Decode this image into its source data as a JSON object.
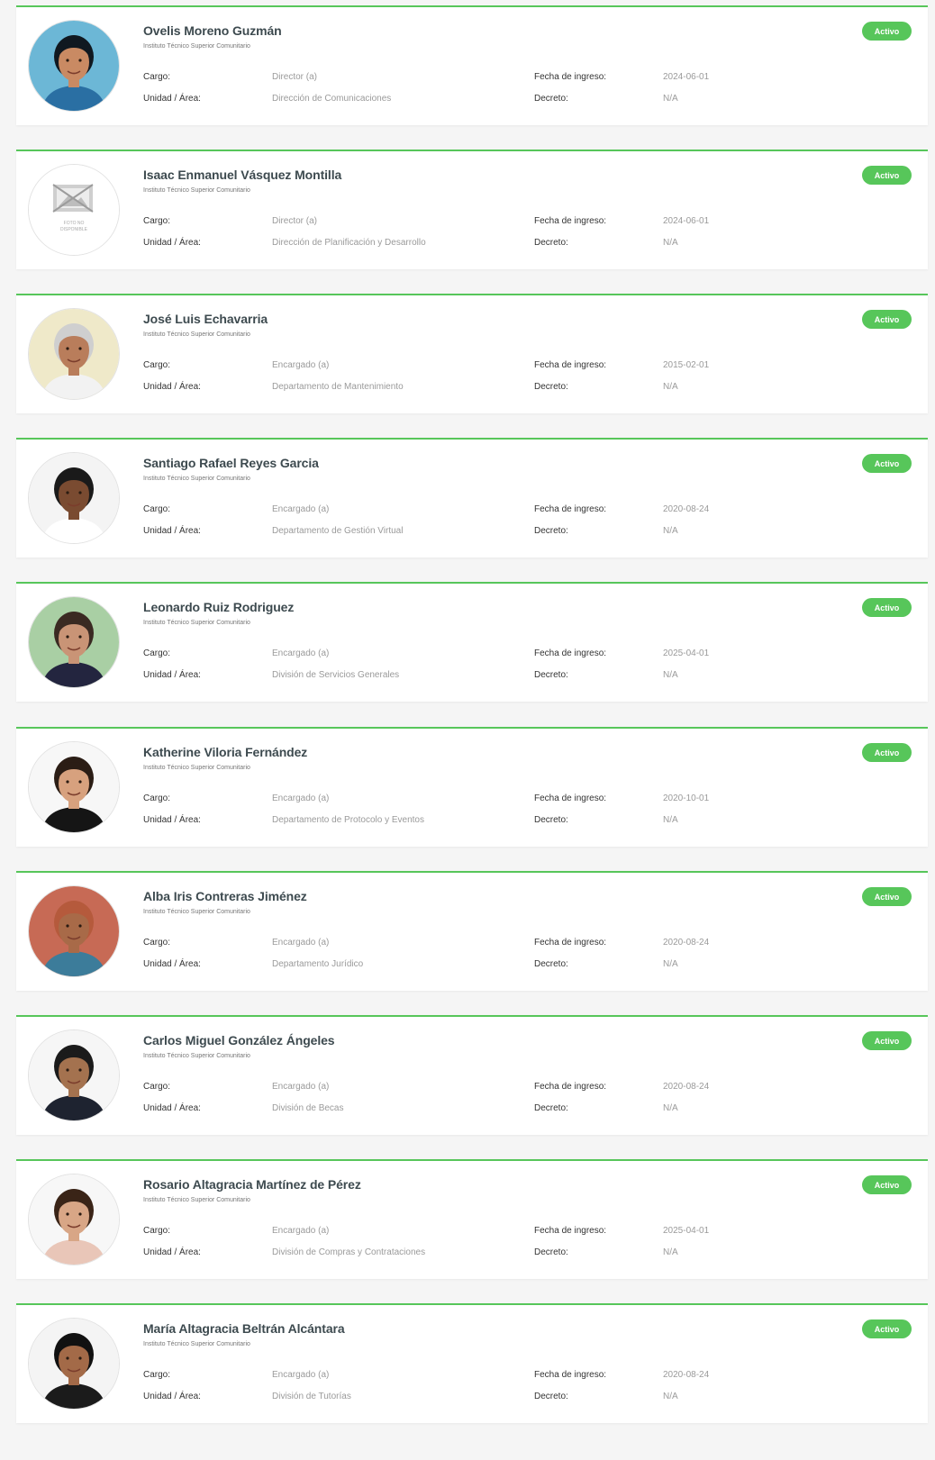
{
  "labels": {
    "cargo": "Cargo:",
    "unidad": "Unidad / Área:",
    "fecha": "Fecha de ingreso:",
    "decreto": "Decreto:"
  },
  "colors": {
    "accent": "#57c65a",
    "card_bg": "#ffffff",
    "page_bg": "#f5f5f5"
  },
  "people": [
    {
      "name": "Ovelis Moreno Guzmán",
      "institution": "Instituto Técnico Superior Comunitario",
      "cargo": "Director (a)",
      "unidad": "Dirección de Comunicaciones",
      "fecha": "2024-06-01",
      "decreto": "N/A",
      "status": "Activo",
      "avatar": {
        "kind": "photo",
        "icon": "person-photo-icon",
        "bg": "#6cb7d6",
        "skin": "#c98a63",
        "hair": "#101820",
        "shirt": "#2a6fa3"
      }
    },
    {
      "name": "Isaac Enmanuel Vásquez Montilla",
      "institution": "Instituto Técnico Superior Comunitario",
      "cargo": "Director (a)",
      "unidad": "Dirección de Planificación y Desarrollo",
      "fecha": "2024-06-01",
      "decreto": "N/A",
      "status": "Activo",
      "avatar": {
        "kind": "placeholder",
        "icon": "no-photo-icon",
        "line1": "FOTO NO",
        "line2": "DISPONIBLE"
      }
    },
    {
      "name": "José Luis Echavarria",
      "institution": "Instituto Técnico Superior Comunitario",
      "cargo": "Encargado (a)",
      "unidad": "Departamento de Mantenimiento",
      "fecha": "2015-02-01",
      "decreto": "N/A",
      "status": "Activo",
      "avatar": {
        "kind": "photo",
        "icon": "person-photo-icon",
        "bg": "#efe9c9",
        "skin": "#b97d5b",
        "hair": "#cfcfcf",
        "shirt": "#f2f2f2"
      }
    },
    {
      "name": "Santiago Rafael Reyes Garcia",
      "institution": "Instituto Técnico Superior Comunitario",
      "cargo": "Encargado (a)",
      "unidad": "Departamento de Gestión Virtual",
      "fecha": "2020-08-24",
      "decreto": "N/A",
      "status": "Activo",
      "avatar": {
        "kind": "photo",
        "icon": "person-photo-icon",
        "bg": "#f4f4f4",
        "skin": "#7a4b31",
        "hair": "#1a1a1a",
        "shirt": "#ffffff"
      }
    },
    {
      "name": "Leonardo Ruiz Rodriguez",
      "institution": "Instituto Técnico Superior Comunitario",
      "cargo": "Encargado (a)",
      "unidad": "División de Servicios Generales",
      "fecha": "2025-04-01",
      "decreto": "N/A",
      "status": "Activo",
      "avatar": {
        "kind": "photo",
        "icon": "person-photo-icon",
        "bg": "#a9cfa4",
        "skin": "#c99476",
        "hair": "#3a2a22",
        "shirt": "#23253f"
      }
    },
    {
      "name": "Katherine Viloria Fernández",
      "institution": "Instituto Técnico Superior Comunitario",
      "cargo": "Encargado (a)",
      "unidad": "Departamento de Protocolo y Eventos",
      "fecha": "2020-10-01",
      "decreto": "N/A",
      "status": "Activo",
      "avatar": {
        "kind": "photo",
        "icon": "person-photo-icon",
        "bg": "#f7f7f7",
        "skin": "#d7a17e",
        "hair": "#2b1d15",
        "shirt": "#151515"
      }
    },
    {
      "name": "Alba Iris Contreras Jiménez",
      "institution": "Instituto Técnico Superior Comunitario",
      "cargo": "Encargado (a)",
      "unidad": "Departamento Jurídico",
      "fecha": "2020-08-24",
      "decreto": "N/A",
      "status": "Activo",
      "avatar": {
        "kind": "photo",
        "icon": "person-photo-icon",
        "bg": "#c76a55",
        "skin": "#a86a48",
        "hair": "#b55a3c",
        "shirt": "#3c7c9a"
      }
    },
    {
      "name": "Carlos Miguel González Ángeles",
      "institution": "Instituto Técnico Superior Comunitario",
      "cargo": "Encargado (a)",
      "unidad": "División de Becas",
      "fecha": "2020-08-24",
      "decreto": "N/A",
      "status": "Activo",
      "avatar": {
        "kind": "photo",
        "icon": "person-photo-icon",
        "bg": "#f6f6f6",
        "skin": "#a4724f",
        "hair": "#1b1b1b",
        "shirt": "#1e2330"
      }
    },
    {
      "name": "Rosario Altagracia Martínez de Pérez",
      "institution": "Instituto Técnico Superior Comunitario",
      "cargo": "Encargado (a)",
      "unidad": "División de Compras y Contrataciones",
      "fecha": "2025-04-01",
      "decreto": "N/A",
      "status": "Activo",
      "avatar": {
        "kind": "photo",
        "icon": "person-photo-icon",
        "bg": "#f7f7f7",
        "skin": "#d8a686",
        "hair": "#3a2417",
        "shirt": "#e9c6b8"
      }
    },
    {
      "name": "María Altagracia Beltrán Alcántara",
      "institution": "Instituto Técnico Superior Comunitario",
      "cargo": "Encargado (a)",
      "unidad": "División de Tutorías",
      "fecha": "2020-08-24",
      "decreto": "N/A",
      "status": "Activo",
      "avatar": {
        "kind": "photo",
        "icon": "person-photo-icon",
        "bg": "#f4f4f4",
        "skin": "#a36a48",
        "hair": "#111111",
        "shirt": "#1b1b1b"
      }
    }
  ]
}
